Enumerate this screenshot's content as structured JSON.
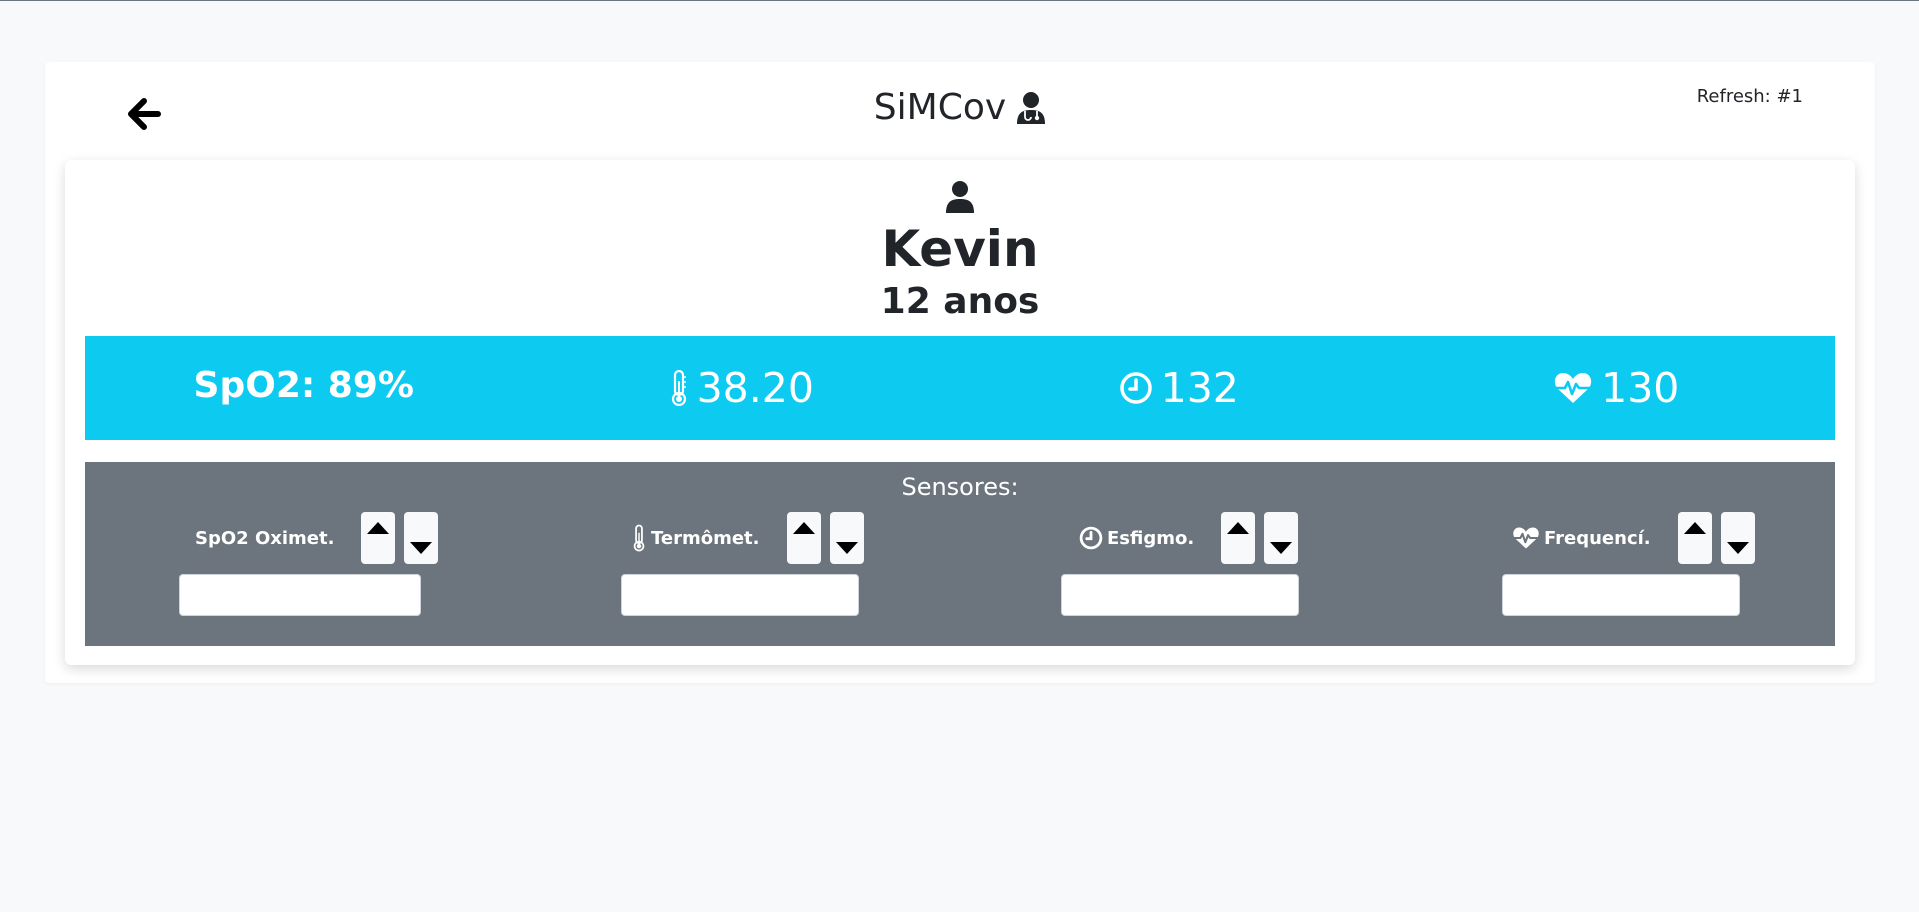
{
  "header": {
    "back_icon": "arrow-left-icon",
    "title": "SiMCov",
    "title_icon": "user-doctor-icon",
    "refresh": "Refresh: #1"
  },
  "patient": {
    "icon": "user-icon",
    "name": "Kevin",
    "age": "12 anos"
  },
  "vitals": {
    "spo2": "SpO2: 89%",
    "temperature": "38.20",
    "temperature_icon": "thermometer-icon",
    "pressure": "132",
    "pressure_icon": "clock-icon",
    "heart_rate": "130",
    "heart_rate_icon": "heart-pulse-icon",
    "accent_color": "#0dcaf0"
  },
  "sensors": {
    "title": "Sensores:",
    "background_color": "#6c757d",
    "items": [
      {
        "label": "SpO2 Oximet.",
        "icon": "",
        "value": "",
        "placeholder": ""
      },
      {
        "label": "Termômet.",
        "icon": "thermometer-icon",
        "value": "",
        "placeholder": ""
      },
      {
        "label": "Esfigmo.",
        "icon": "clock-icon",
        "value": "",
        "placeholder": ""
      },
      {
        "label": "Frequencí.",
        "icon": "heart-pulse-icon",
        "value": "",
        "placeholder": ""
      }
    ]
  }
}
